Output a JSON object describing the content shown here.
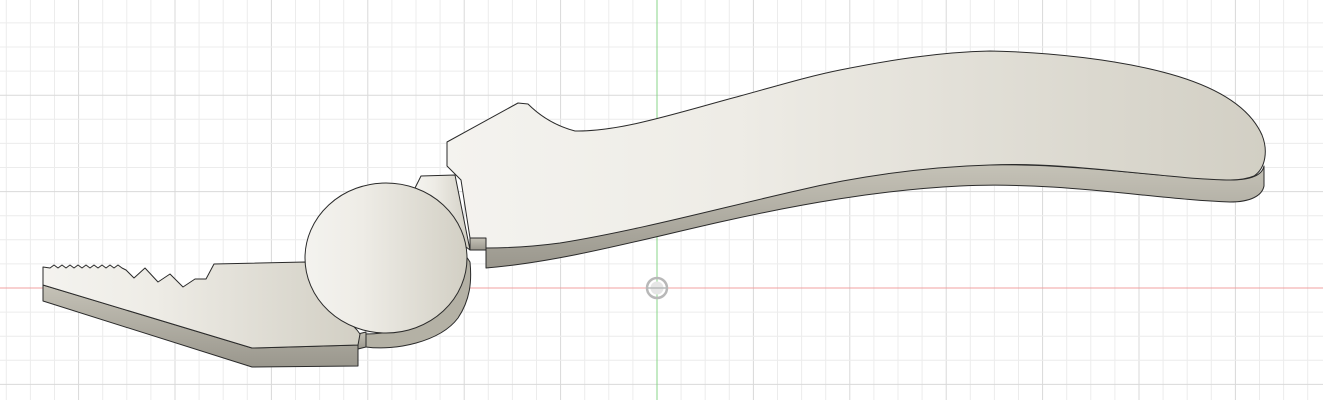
{
  "viewport": {
    "background": "#ffffff",
    "grid": {
      "visible": true,
      "minor_color": "#ececec",
      "major_color": "#d9d9d9"
    },
    "axes": {
      "x_axis_color": "#f0a0a0",
      "y_axis_color": "#88d488"
    },
    "origin_marker": {
      "icon": "origin-point-icon",
      "color": "#b8b8b8"
    }
  },
  "model": {
    "parts": [
      {
        "name": "pliers-jaw"
      },
      {
        "name": "pivot-hub"
      },
      {
        "name": "pliers-handle"
      }
    ],
    "colors": {
      "top_face_light": "#f4f3ef",
      "top_face_dark": "#d2cfc4",
      "side_face": "#b4b1a5",
      "side_face_dark": "#8d8a80",
      "edge": "#2a2a2a",
      "shadow": "#dedbd2"
    }
  }
}
